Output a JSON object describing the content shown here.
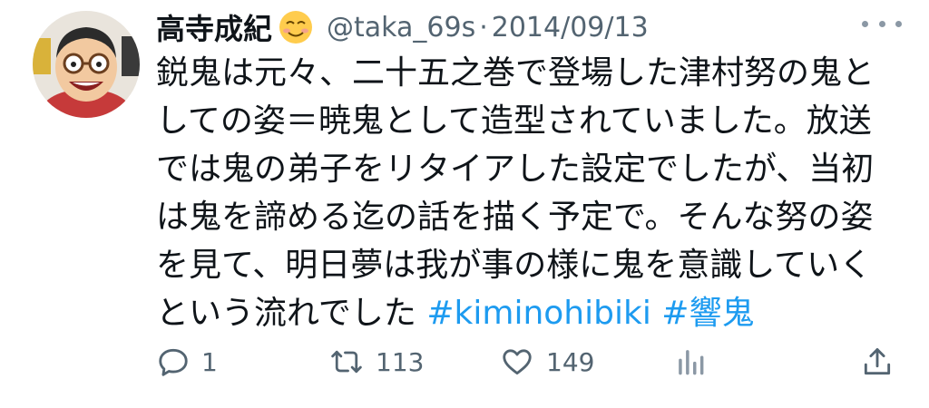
{
  "tweet": {
    "display_name": "高寺成紀",
    "name_emoji": "smiling-face-emoji",
    "handle": "@taka_69s",
    "separator": "·",
    "date": "2014/09/13",
    "body_lines": [
      "鋭鬼は元々、二十五之巻で登場した津村努の鬼と",
      "しての姿＝暁鬼として造型されていました。放送",
      "では鬼の弟子をリタイアした設定でしたが、当初",
      "は鬼を諦める迄の話を描く予定で。そんな努の姿",
      "を見て、明日夢は我が事の様に鬼を意識していく"
    ],
    "last_line_text": "という流れでした ",
    "hashtags": [
      "#kiminohibiki",
      "#響鬼"
    ]
  },
  "actions": {
    "reply_count": "1",
    "retweet_count": "113",
    "like_count": "149"
  },
  "icons": {
    "avatar": "cartoon-avatar-icon",
    "more": "more-options-icon",
    "reply": "reply-icon",
    "retweet": "retweet-icon",
    "like": "heart-icon",
    "views": "views-chart-icon",
    "share": "share-icon"
  },
  "colors": {
    "text": "#0f1419",
    "secondary": "#536471",
    "link": "#1d9bf0",
    "icon": "#8b98a5"
  }
}
